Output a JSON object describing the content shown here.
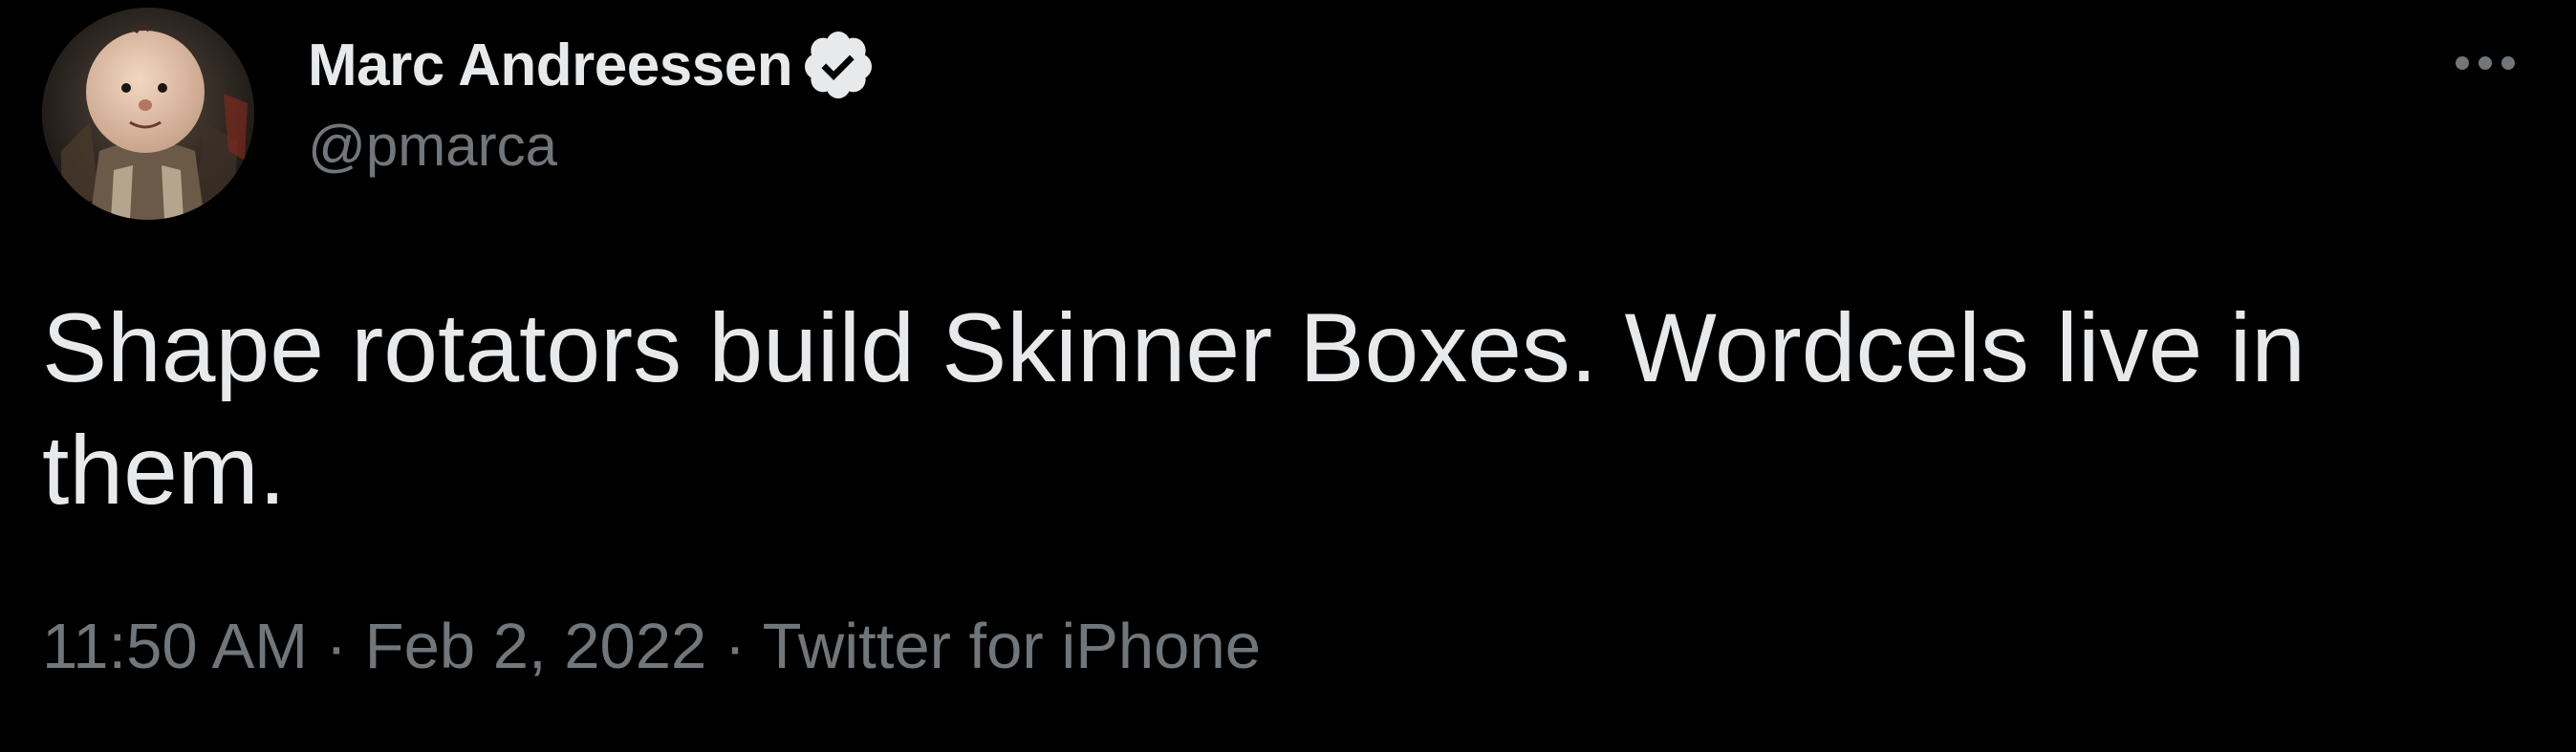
{
  "tweet": {
    "author": {
      "display_name": "Marc Andreessen",
      "handle": "@pmarca",
      "verified": true,
      "avatar": "profile-photo"
    },
    "text": "Shape rotators build Skinner Boxes. Wordcels live in them.",
    "time": "11:50 AM",
    "separator": "·",
    "date": "Feb 2, 2022",
    "source": "Twitter for iPhone",
    "more_icon": "more-horizontal-icon",
    "verified_icon": "verified-badge-icon"
  },
  "colors": {
    "background": "#000000",
    "primary_text": "#e7e9ea",
    "secondary_text": "#71767b",
    "badge": "#e7e9ea"
  }
}
